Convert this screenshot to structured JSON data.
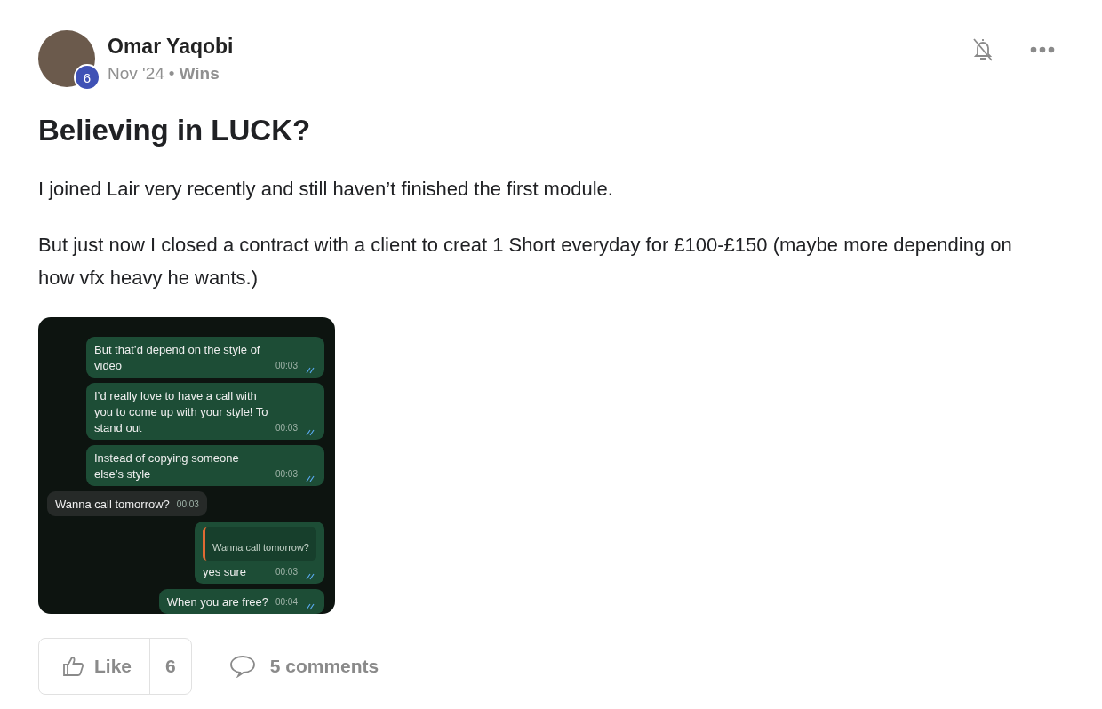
{
  "author": {
    "name": "Omar Yaqobi",
    "level": "6",
    "date": "Nov '24",
    "separator": "•",
    "category": "Wins"
  },
  "post": {
    "title": "Believing in LUCK?",
    "paragraphs": [
      "I joined Lair very recently and still haven’t finished the first module.",
      "But just now I closed a contract with a client to creat 1 Short everyday for £100-£150 (maybe more depending on how vfx heavy he wants.)"
    ]
  },
  "chat": {
    "messages": [
      {
        "kind": "outgoing",
        "text": "But that’d depend on the style of video",
        "time": "00:03",
        "read": true
      },
      {
        "kind": "outgoing",
        "text": "I’d really love to have a call with you to come up with your style! To stand out",
        "time": "00:03",
        "read": true
      },
      {
        "kind": "outgoing",
        "text": "Instead of copying someone else’s style",
        "time": "00:03",
        "read": true
      },
      {
        "kind": "incoming",
        "text": "Wanna call tomorrow?",
        "time": "00:03"
      },
      {
        "kind": "reply",
        "quote": "Wanna call tomorrow?",
        "text": "yes sure",
        "time": "00:03",
        "read": true
      },
      {
        "kind": "outgoing",
        "text": "When you are free?",
        "time": "00:04",
        "read": true
      }
    ]
  },
  "actions": {
    "like_label": "Like",
    "like_count": "6",
    "liked": false,
    "comments": "5 comments"
  }
}
